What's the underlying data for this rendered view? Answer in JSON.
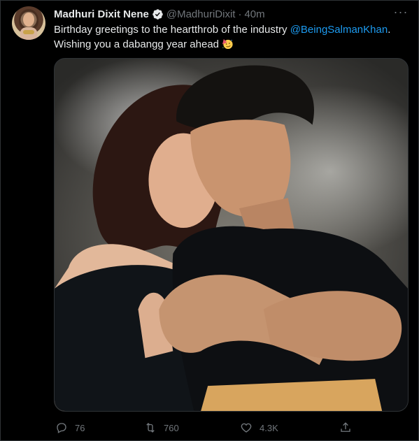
{
  "tweet": {
    "author": {
      "name": "Madhuri Dixit Nene",
      "handle": "@MadhuriDixit",
      "separator": "·",
      "time": "40m",
      "verified": true
    },
    "more_label": "···",
    "text": {
      "lead": "Birthday greetings to the heartthrob of the industry ",
      "mention": "@BeingSalmanKhan",
      "after_mention": ".",
      "line2": "Wishing you a dabangg year ahead "
    },
    "emoji": "partying-face-emoji",
    "actions": {
      "replies": "76",
      "retweets": "760",
      "likes": "4.3K"
    },
    "icons": [
      "verified-badge-icon",
      "more-icon",
      "reply-icon",
      "retweet-icon",
      "like-icon",
      "share-icon"
    ]
  },
  "colors": {
    "background": "#000000",
    "text": "#e7e9ea",
    "muted": "#71767b",
    "accent": "#1d9bf0",
    "border": "#2f3336"
  }
}
